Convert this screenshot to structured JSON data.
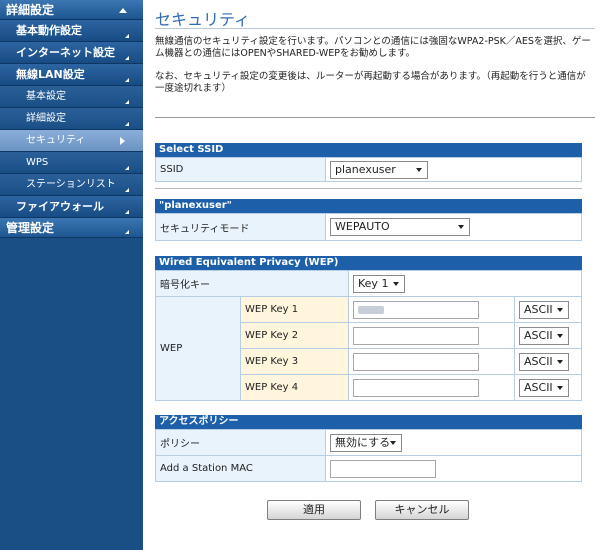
{
  "sidebar": {
    "items": [
      {
        "label": "詳細設定"
      },
      {
        "label": "基本動作設定"
      },
      {
        "label": "インターネット設定"
      },
      {
        "label": "無線LAN設定"
      },
      {
        "label": "基本設定"
      },
      {
        "label": "詳細設定"
      },
      {
        "label": "セキュリティ"
      },
      {
        "label": "WPS"
      },
      {
        "label": "ステーションリスト"
      },
      {
        "label": "ファイアウォール"
      },
      {
        "label": "管理設定"
      }
    ]
  },
  "page": {
    "title": "セキュリティ",
    "desc1": "無線通信のセキュリティ設定を行います。パソコンとの通信には強固なWPA2-PSK／AESを選択、ゲーム機器との通信にはOPENやSHARED-WEPをお勧めします。",
    "desc2": "なお、セキュリティ設定の変更後は、ルーターが再起動する場合があります。（再起動を行うと通信が一度途切れます）"
  },
  "select_ssid": {
    "header": "Select SSID",
    "label": "SSID",
    "value": "planexuser"
  },
  "ssid_section": {
    "header": "\"planexuser\"",
    "mode_label": "セキュリティモード",
    "mode_value": "WEPAUTO"
  },
  "wep": {
    "header": "Wired Equivalent Privacy (WEP)",
    "enc_key_label": "暗号化キー",
    "enc_key_value": "Key 1",
    "wep_label": "WEP",
    "keys": [
      {
        "label": "WEP Key 1",
        "format": "ASCII"
      },
      {
        "label": "WEP Key 2",
        "format": "ASCII"
      },
      {
        "label": "WEP Key 3",
        "format": "ASCII"
      },
      {
        "label": "WEP Key 4",
        "format": "ASCII"
      }
    ]
  },
  "access": {
    "header": "アクセスポリシー",
    "policy_label": "ポリシー",
    "policy_value": "無効にする",
    "mac_label": "Add a Station MAC"
  },
  "buttons": {
    "apply": "適用",
    "cancel": "キャンセル"
  }
}
